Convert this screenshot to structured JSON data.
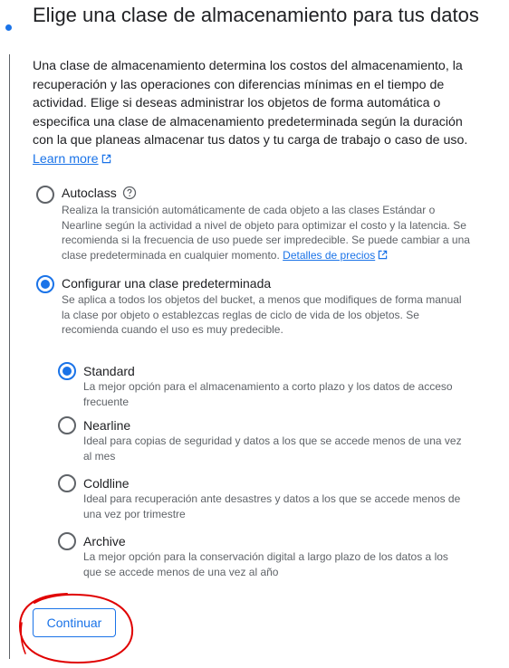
{
  "section": {
    "title": "Elige una clase de almacenamiento para tus datos",
    "description": "Una clase de almacenamiento determina los costos del almacenamiento, la recuperación y las operaciones con diferencias mínimas en el tiempo de actividad. Elige si deseas administrar los objetos de forma automática o especifica una clase de almacenamiento predeterminada según la duración con la que planeas almacenar tus datos y tu carga de trabajo o caso de uso.",
    "learn_more": "Learn more"
  },
  "options": {
    "autoclass": {
      "label": "Autoclass",
      "selected": false,
      "description": "Realiza la transición automáticamente de cada objeto a las clases Estándar o Nearline según la actividad a nivel de objeto para optimizar el costo y la latencia. Se recomienda si la frecuencia de uso puede ser impredecible. Se puede cambiar a una clase predeterminada en cualquier momento.",
      "pricing_link": "Detalles de precios"
    },
    "default_class": {
      "label": "Configurar una clase predeterminada",
      "selected": true,
      "description": "Se aplica a todos los objetos del bucket, a menos que modifiques de forma manual la clase por objeto o establezcas reglas de ciclo de vida de los objetos. Se recomienda cuando el uso es muy predecible."
    }
  },
  "classes": [
    {
      "label": "Standard",
      "selected": true,
      "description": "La mejor opción para el almacenamiento a corto plazo y los datos de acceso frecuente"
    },
    {
      "label": "Nearline",
      "selected": false,
      "description": "Ideal para copias de seguridad y datos a los que se accede menos de una vez al mes"
    },
    {
      "label": "Coldline",
      "selected": false,
      "description": "Ideal para recuperación ante desastres y datos a los que se accede menos de una vez por trimestre"
    },
    {
      "label": "Archive",
      "selected": false,
      "description": "La mejor opción para la conservación digital a largo plazo de los datos a los que se accede menos de una vez al año"
    }
  ],
  "actions": {
    "continue_label": "Continuar"
  },
  "colors": {
    "accent": "#1a73e8",
    "annotation": "#e00000"
  }
}
